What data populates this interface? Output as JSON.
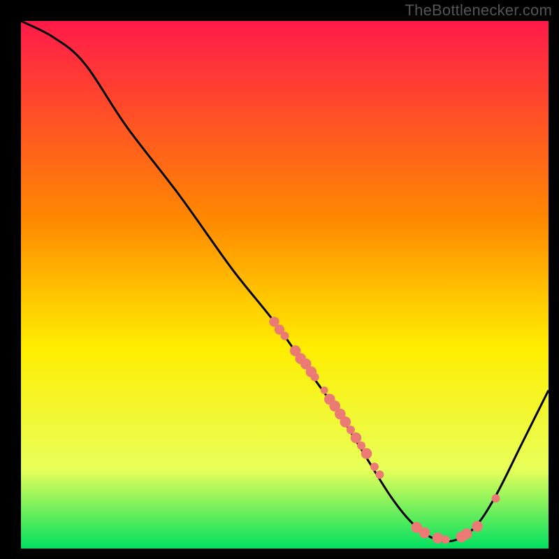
{
  "watermark": "TheBottlenecker.com",
  "colors": {
    "bg": "#000000",
    "curve": "#000000",
    "dot": "#ec7a74",
    "grad_top": "#ff1a4a",
    "grad_mid1": "#ff8a00",
    "grad_mid2": "#ffee00",
    "grad_mid3": "#e8ff5a",
    "grad_bot": "#00e060"
  },
  "chart_data": {
    "type": "line",
    "title": "",
    "xlabel": "",
    "ylabel": "",
    "xlim": [
      0,
      100
    ],
    "ylim": [
      0,
      100
    ],
    "curve": [
      {
        "x": 0,
        "y": 100
      },
      {
        "x": 6,
        "y": 97
      },
      {
        "x": 12,
        "y": 92
      },
      {
        "x": 20,
        "y": 80
      },
      {
        "x": 30,
        "y": 67
      },
      {
        "x": 40,
        "y": 53
      },
      {
        "x": 48,
        "y": 43
      },
      {
        "x": 55,
        "y": 33
      },
      {
        "x": 60,
        "y": 26
      },
      {
        "x": 65,
        "y": 18
      },
      {
        "x": 70,
        "y": 10
      },
      {
        "x": 74,
        "y": 5
      },
      {
        "x": 78,
        "y": 2
      },
      {
        "x": 82,
        "y": 1.5
      },
      {
        "x": 86,
        "y": 4
      },
      {
        "x": 90,
        "y": 10
      },
      {
        "x": 95,
        "y": 20
      },
      {
        "x": 100,
        "y": 30
      }
    ],
    "points": [
      {
        "x": 48,
        "y": 43,
        "r": 1.2
      },
      {
        "x": 49,
        "y": 41.5,
        "r": 1.2
      },
      {
        "x": 50,
        "y": 40.3,
        "r": 1.0
      },
      {
        "x": 52,
        "y": 37.5,
        "r": 1.3
      },
      {
        "x": 53,
        "y": 36,
        "r": 1.3
      },
      {
        "x": 54,
        "y": 35,
        "r": 1.3
      },
      {
        "x": 55,
        "y": 33.5,
        "r": 1.3
      },
      {
        "x": 55.7,
        "y": 32.5,
        "r": 1.0
      },
      {
        "x": 57.5,
        "y": 30,
        "r": 0.9
      },
      {
        "x": 58.5,
        "y": 28.3,
        "r": 1.3
      },
      {
        "x": 59.5,
        "y": 27,
        "r": 1.3
      },
      {
        "x": 60.5,
        "y": 25.5,
        "r": 1.3
      },
      {
        "x": 61.5,
        "y": 24,
        "r": 1.3
      },
      {
        "x": 62.5,
        "y": 22.5,
        "r": 1.0
      },
      {
        "x": 63.5,
        "y": 21,
        "r": 1.3
      },
      {
        "x": 64.5,
        "y": 19.5,
        "r": 1.0
      },
      {
        "x": 65.5,
        "y": 18,
        "r": 1.3
      },
      {
        "x": 67,
        "y": 15.5,
        "r": 1.0
      },
      {
        "x": 68,
        "y": 14,
        "r": 1.0
      },
      {
        "x": 75,
        "y": 4,
        "r": 1.3
      },
      {
        "x": 76.5,
        "y": 3,
        "r": 1.3
      },
      {
        "x": 79,
        "y": 2,
        "r": 1.3
      },
      {
        "x": 80.5,
        "y": 1.7,
        "r": 1.0
      },
      {
        "x": 83.5,
        "y": 2.2,
        "r": 1.3
      },
      {
        "x": 84.5,
        "y": 2.8,
        "r": 1.3
      },
      {
        "x": 86.5,
        "y": 4.2,
        "r": 1.3
      },
      {
        "x": 90,
        "y": 9.5,
        "r": 1.0
      }
    ]
  }
}
